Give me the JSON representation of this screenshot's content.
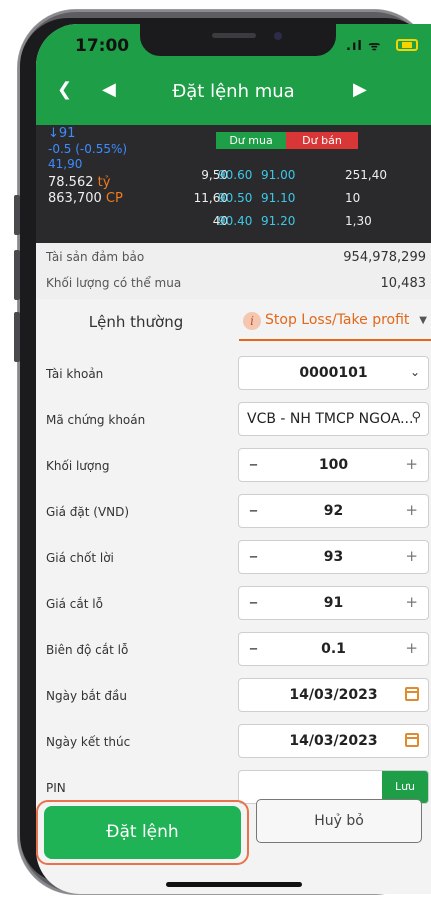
{
  "status": {
    "time": "17:00",
    "signal": ".ıl ᯤ"
  },
  "header": {
    "title": "Đặt lệnh mua",
    "back_icon": "chevron-left",
    "prev_icon": "triangle-left",
    "next_icon": "triangle-right"
  },
  "board": {
    "price": "91",
    "change": "-0.5 (-0.55%)",
    "ref_price": "41,90",
    "value": "78.562",
    "value_unit": "tỷ",
    "volume": "863,700",
    "volume_unit": "CP",
    "buy_header": "Dư mua",
    "sell_header": "Dư bán",
    "rows": [
      {
        "buy_vol": "9,50",
        "buy_price": "90.60",
        "sell_price": "91.00",
        "sell_vol": "251,40"
      },
      {
        "buy_vol": "11,60",
        "buy_price": "90.50",
        "sell_price": "91.10",
        "sell_vol": "10"
      },
      {
        "buy_vol": "40",
        "buy_price": "90.40",
        "sell_price": "91.20",
        "sell_vol": "1,30"
      }
    ]
  },
  "info": {
    "collateral_label": "Tài sản đảm bảo",
    "collateral_value": "954,978,299",
    "buyable_label": "Khối lượng có thể mua",
    "buyable_value": "10,483"
  },
  "tabs": {
    "normal": "Lệnh thường",
    "stop": "Stop Loss/Take profit"
  },
  "form": {
    "account_label": "Tài khoản",
    "account_value": "0000101",
    "symbol_label": "Mã chứng khoán",
    "symbol_value": "VCB - NH TMCP NGOA...",
    "qty_label": "Khối lượng",
    "qty_value": "100",
    "price_label": "Giá đặt (VND)",
    "price_value": "92",
    "tp_label": "Giá chốt lời",
    "tp_value": "93",
    "sl_label": "Giá cắt lỗ",
    "sl_value": "91",
    "range_label": "Biên độ cắt lỗ",
    "range_value": "0.1",
    "start_label": "Ngày bắt đầu",
    "start_value": "14/03/2023",
    "end_label": "Ngày kết thúc",
    "end_value": "14/03/2023",
    "pin_label": "PIN",
    "pin_value": "",
    "pin_save": "Lưu"
  },
  "actions": {
    "submit": "Đặt lệnh",
    "cancel": "Huỷ bỏ"
  },
  "colors": {
    "brand_green": "#1e9e47",
    "accent_orange": "#e2681a",
    "sell_red": "#d93737"
  }
}
